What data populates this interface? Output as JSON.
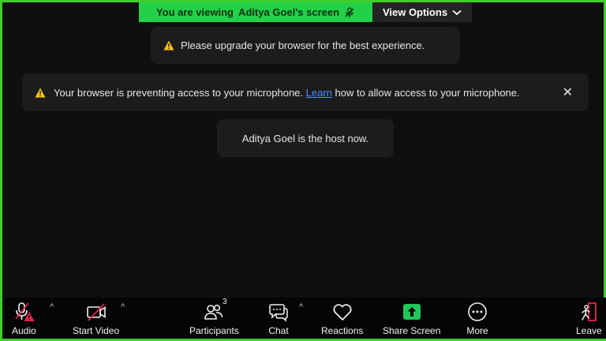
{
  "banner": {
    "viewing_prefix": "You are viewing",
    "viewing_name": "Aditya Goel's screen",
    "view_options_label": "View Options"
  },
  "toasts": {
    "upgrade": "Please upgrade your browser for the best experience.",
    "mic_before": "Your browser is preventing access to your microphone.",
    "mic_link": "Learn",
    "mic_after": "how to allow access to your microphone.",
    "mic_close": "✕",
    "host": "Aditya Goel is the host now."
  },
  "toolbar": {
    "audio": "Audio",
    "start_video": "Start Video",
    "participants": "Participants",
    "participants_count": "3",
    "chat": "Chat",
    "reactions": "Reactions",
    "share_screen": "Share Screen",
    "more": "More",
    "leave": "Leave"
  },
  "colors": {
    "border_accent": "#3fce2a",
    "banner_green": "#23d148",
    "share_green": "#20c75a",
    "warning_yellow": "#f5c518",
    "alert_red": "#e8244a",
    "link_blue": "#4a8cff"
  },
  "icons": {
    "audio": "mic-muted-warning-icon",
    "video": "video-off-icon",
    "participants": "participants-icon",
    "chat": "chat-icon",
    "reactions": "heart-icon",
    "share": "share-screen-icon",
    "more": "more-icon",
    "leave": "leave-icon"
  }
}
